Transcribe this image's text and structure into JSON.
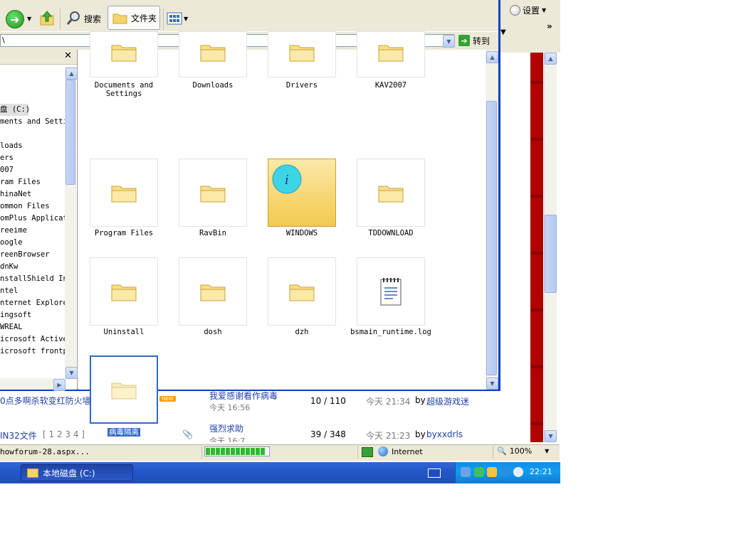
{
  "ie": {
    "settings_label": "设置",
    "chevron": "»",
    "rows": [
      {
        "title": "0点多啊杀软变红防火墙变灰急急急!!!",
        "badge": "NEW",
        "last_topic": "我爱感谢看作病毒",
        "last_date": "今天 16:56",
        "stats": "10 / 110",
        "last_time": "今天 21:34",
        "by": "by",
        "last_user": "超级游戏迷"
      },
      {
        "title": "IN32文件",
        "pages": "[ 1 2 3 4 ]",
        "last_topic": "强烈求助",
        "last_date": "今天 16:7",
        "stats": "39 / 348",
        "last_time": "今天 21:23",
        "by": "by",
        "last_user": "byxxdrls"
      }
    ],
    "status_text": "howforum-28.aspx...",
    "zone": "Internet",
    "zoom": "100%"
  },
  "taskbar": {
    "task_label": "本地磁盘 (C:)",
    "clock": "22:21"
  },
  "explorer": {
    "toolbar": {
      "search_label": "搜索",
      "folders_label": "文件夹"
    },
    "address": {
      "value": "\\",
      "go_label": "转到"
    },
    "tree": [
      {
        "label": "盘 (C:)",
        "selected": true
      },
      {
        "label": "ments and Settings"
      },
      {
        "label": "loads"
      },
      {
        "label": "ers"
      },
      {
        "label": "007"
      },
      {
        "label": "ram Files"
      },
      {
        "label": "hinaNet"
      },
      {
        "label": "ommon Files"
      },
      {
        "label": "omPlus Applications"
      },
      {
        "label": "reeime"
      },
      {
        "label": "oogle"
      },
      {
        "label": "reenBrowser"
      },
      {
        "label": "dnKw"
      },
      {
        "label": "nstallShield Installation"
      },
      {
        "label": "ntel"
      },
      {
        "label": "nternet Explorer"
      },
      {
        "label": "ingsoft"
      },
      {
        "label": "WREAL"
      },
      {
        "label": "icrosoft ActiveSync"
      },
      {
        "label": "icrosoft frontpage"
      }
    ],
    "items": [
      {
        "label": "Documents and\nSettings",
        "type": "folder"
      },
      {
        "label": "Downloads",
        "type": "folder"
      },
      {
        "label": "Drivers",
        "type": "folder"
      },
      {
        "label": "KAV2007",
        "type": "folder"
      },
      {
        "label": "Program Files",
        "type": "folder"
      },
      {
        "label": "RavBin",
        "type": "folder"
      },
      {
        "label": "WINDOWS",
        "type": "windows-folder"
      },
      {
        "label": "TDDOWNLOAD",
        "type": "folder"
      },
      {
        "label": "Uninstall",
        "type": "folder"
      },
      {
        "label": "dosh",
        "type": "folder"
      },
      {
        "label": "dzh",
        "type": "folder"
      },
      {
        "label": "bsmain_runtime.log",
        "type": "log"
      },
      {
        "label": "病毒隔离",
        "type": "folder-selected"
      }
    ]
  }
}
